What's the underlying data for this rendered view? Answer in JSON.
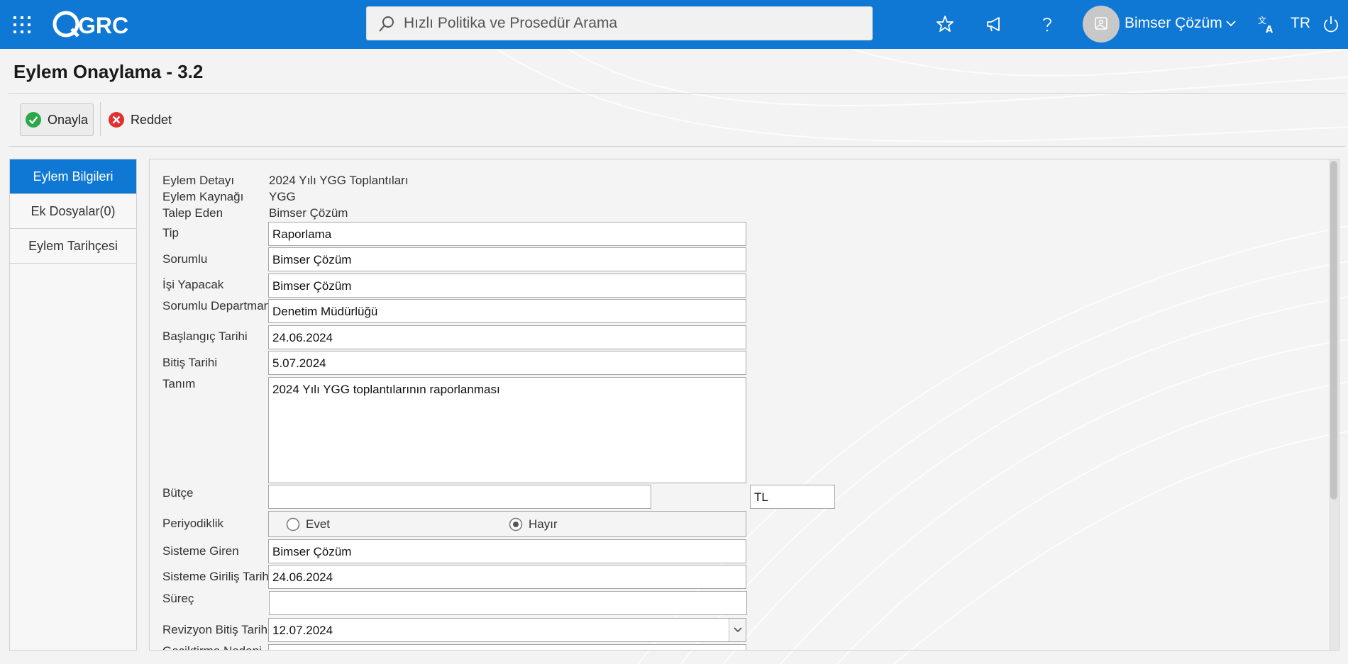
{
  "header": {
    "logo": "GRC",
    "search_placeholder": "Hızlı Politika ve Prosedür Arama",
    "user_name": "Bimser Çözüm",
    "language": "TR",
    "brand_color": "#0f78d4"
  },
  "page": {
    "title": "Eylem Onaylama - 3.2"
  },
  "toolbar": {
    "approve_label": "Onayla",
    "reject_label": "Reddet"
  },
  "tabs": [
    {
      "label": "Eylem Bilgileri",
      "active": true
    },
    {
      "label": "Ek Dosyalar(0)",
      "active": false
    },
    {
      "label": "Eylem Tarihçesi",
      "active": false
    }
  ],
  "form": {
    "eylem_detayi_label": "Eylem Detayı",
    "eylem_detayi": "2024 Yılı YGG Toplantıları",
    "eylem_kaynagi_label": "Eylem Kaynağı",
    "eylem_kaynagi": "YGG",
    "talep_eden_label": "Talep Eden",
    "talep_eden": "Bimser Çözüm",
    "tip_label": "Tip",
    "tip": "Raporlama",
    "sorumlu_label": "Sorumlu",
    "sorumlu": "Bimser Çözüm",
    "isi_yapacak_label": "İşi Yapacak",
    "isi_yapacak": "Bimser Çözüm",
    "sorumlu_departman_label": "Sorumlu Departman",
    "sorumlu_departman": "Denetim Müdürlüğü",
    "baslangic_label": "Başlangıç Tarihi",
    "baslangic": "24.06.2024",
    "bitis_label": "Bitiş Tarihi",
    "bitis": "5.07.2024",
    "tanim_label": "Tanım",
    "tanim": "2024 Yılı YGG toplantılarının raporlanması",
    "butce_label": "Bütçe",
    "butce": "",
    "currency": "TL",
    "periyodiklik_label": "Periyodiklik",
    "evet_label": "Evet",
    "hayir_label": "Hayır",
    "periyodiklik_selected": "Hayır",
    "sisteme_giren_label": "Sisteme Giren",
    "sisteme_giren": "Bimser Çözüm",
    "giris_tarihi_label": "Sisteme Giriliş Tarihi",
    "giris_tarihi": "24.06.2024",
    "surec_label": "Süreç",
    "surec": "",
    "revizyon_label": "Revizyon Bitiş Tarihi",
    "revizyon": "12.07.2024",
    "geciktirme_label": "Geciktirme Nedeni"
  }
}
